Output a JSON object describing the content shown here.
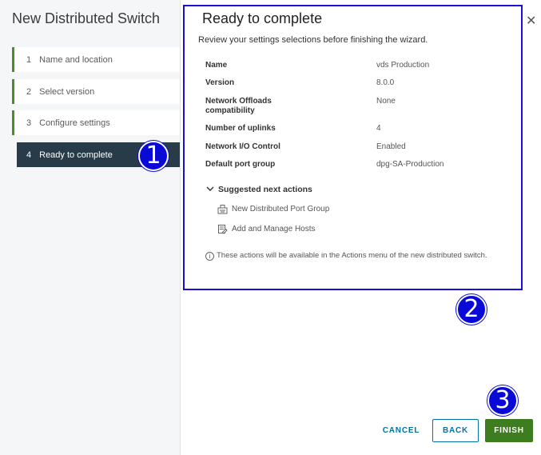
{
  "nav": {
    "title": "New Distributed Switch",
    "steps": [
      {
        "num": "1",
        "label": "Name and location"
      },
      {
        "num": "2",
        "label": "Select version"
      },
      {
        "num": "3",
        "label": "Configure settings"
      },
      {
        "num": "4",
        "label": "Ready to complete"
      }
    ]
  },
  "content": {
    "title": "Ready to complete",
    "subtitle": "Review your settings selections before finishing the wizard.",
    "rows": [
      {
        "label": "Name",
        "value": "vds Production"
      },
      {
        "label": "Version",
        "value": "8.0.0"
      },
      {
        "label": "Network Offloads",
        "label2": "compatibility",
        "value": "None"
      },
      {
        "label": "Number of uplinks",
        "value": "4"
      },
      {
        "label": "Network I/O Control",
        "value": "Enabled"
      },
      {
        "label": "Default port group",
        "value": "dpg-SA-Production"
      }
    ],
    "suggested": {
      "heading": "Suggested next actions",
      "actions": [
        "New Distributed Port Group",
        "Add and Manage Hosts"
      ]
    },
    "note": "These actions will be available in the Actions menu of the new distributed switch."
  },
  "footer": {
    "cancel": "CANCEL",
    "back": "BACK",
    "finish": "FINISH"
  },
  "badges": [
    "1",
    "2",
    "3"
  ],
  "colors": {
    "step_accent": "#4a8e2a",
    "active_step_bg": "#283b48",
    "primary_link": "#0072a3",
    "finish_bg": "#3d7d1f",
    "badge": "#0a0ad6",
    "highlight_border": "#1a0fd6"
  },
  "icons": {
    "close": "close-icon",
    "chevron": "chevron-down-icon",
    "port_group": "port-group-icon",
    "hosts": "manage-hosts-icon",
    "info": "info-icon"
  }
}
